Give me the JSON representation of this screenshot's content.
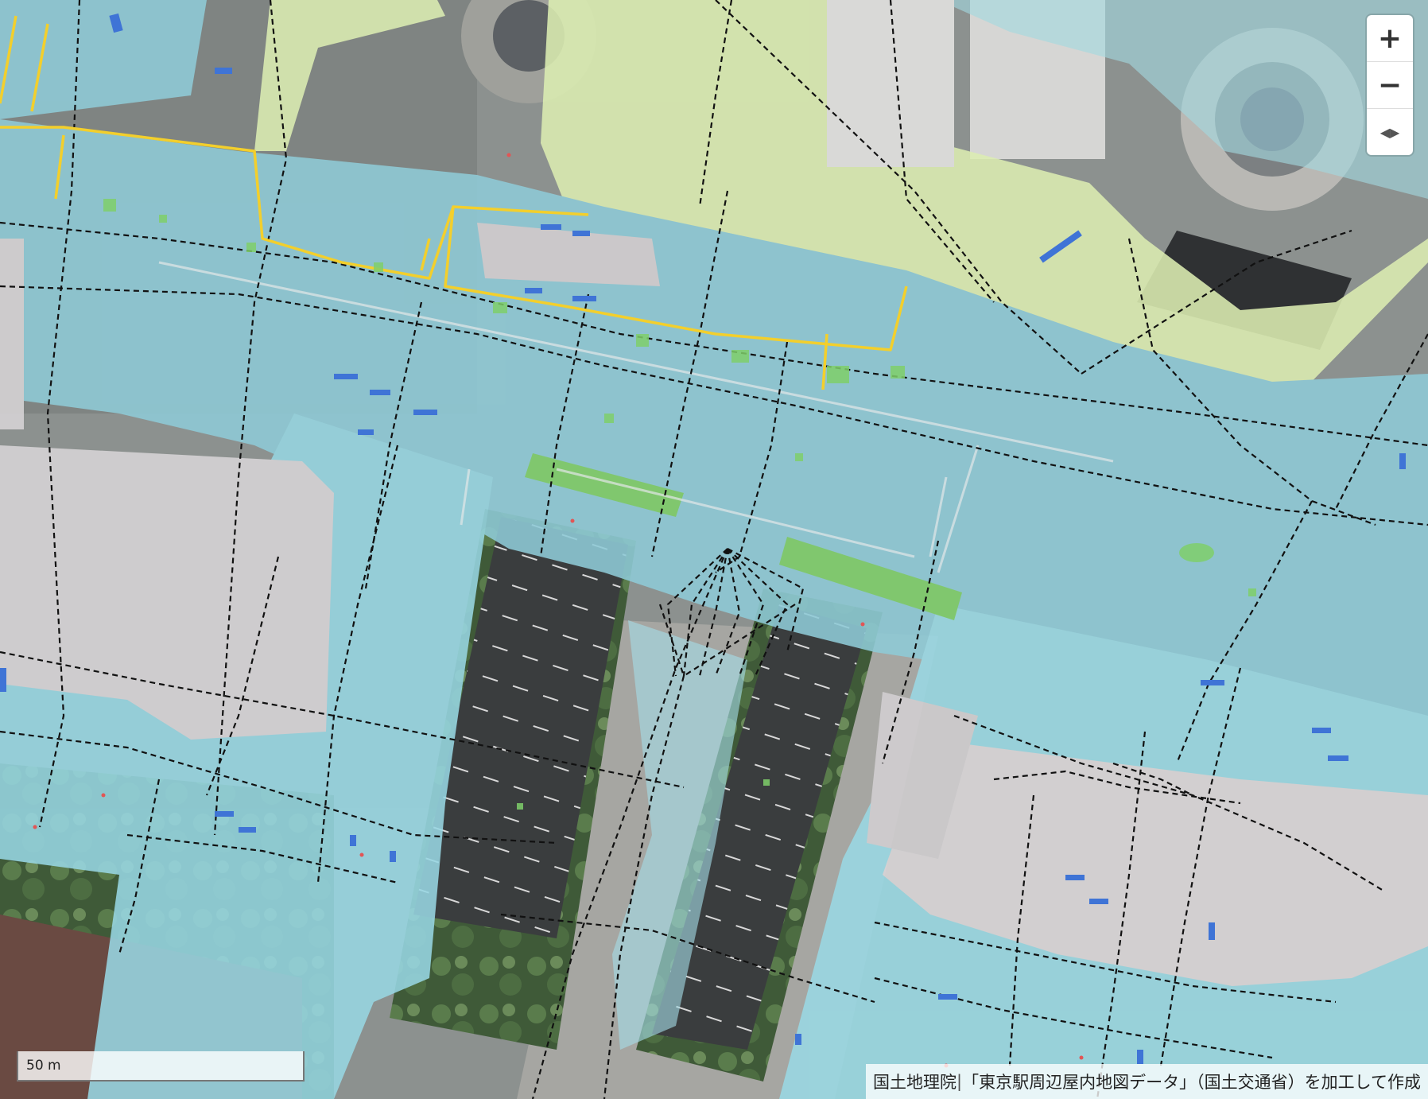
{
  "controls": {
    "zoom_in_label": "+",
    "zoom_out_label": "−",
    "compass_label": "◀▶"
  },
  "scale": {
    "label": "50 m"
  },
  "attribution": {
    "source": "国土地理院",
    "separator": " | ",
    "credit": "「東京駅周辺屋内地図データ」（国土交通省）を加工して作成"
  },
  "colors": {
    "indoor_area": "#9fd8e2",
    "plaza_area": "#d9ecb0",
    "building_area": "#d9d6d8",
    "network_line": "#111111",
    "highlight_route": "#f3cf2c",
    "door_marker": "#3f74d6"
  }
}
